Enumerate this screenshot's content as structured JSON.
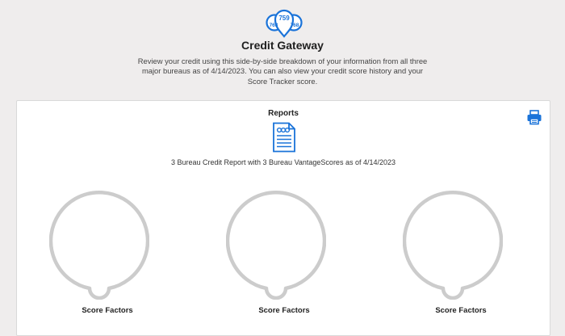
{
  "header": {
    "logo_scores": [
      "759",
      "763",
      "768"
    ],
    "title": "Credit Gateway",
    "description": "Review your credit using this side-by-side breakdown of your information from all three major bureaus as of 4/14/2023. You can also view your credit score history and your Score Tracker score."
  },
  "reports": {
    "heading": "Reports",
    "report_link": "3 Bureau Credit Report with 3 Bureau VantageScores as of 4/14/2023",
    "print_icon": "printer-icon",
    "document_icon": "credit-report-document-icon"
  },
  "gauges": [
    {
      "label": "Score Factors"
    },
    {
      "label": "Score Factors"
    },
    {
      "label": "Score Factors"
    }
  ],
  "colors": {
    "accent": "#1a73d9",
    "gauge_ring": "#cccccc",
    "background": "#efeded",
    "card": "#ffffff"
  }
}
